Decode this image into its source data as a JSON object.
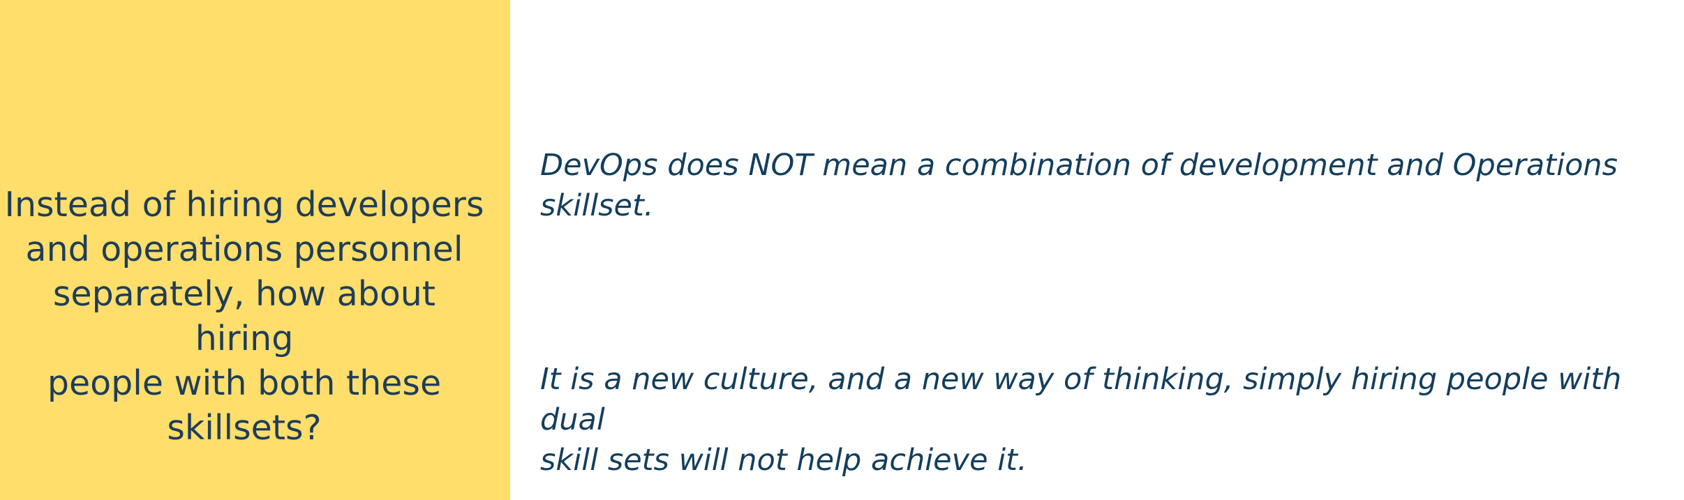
{
  "question": {
    "line1": "Instead of hiring developers",
    "line2": "and operations personnel",
    "line3": "separately, how about hiring",
    "line4": "people with both these",
    "line5": "skillsets?"
  },
  "answers": [
    {
      "line1": "DevOps does NOT mean a combination of development and Operations",
      "line2": "skillset."
    },
    {
      "line1": "It is a new culture, and a new way of thinking, simply hiring people with dual",
      "line2": "skill sets will not help achieve it."
    }
  ],
  "colors": {
    "panel_background": "#FFDE6B",
    "question_text": "#1F3D5A",
    "answer_text": "#143E5C",
    "page_background": "#FFFFFF"
  }
}
